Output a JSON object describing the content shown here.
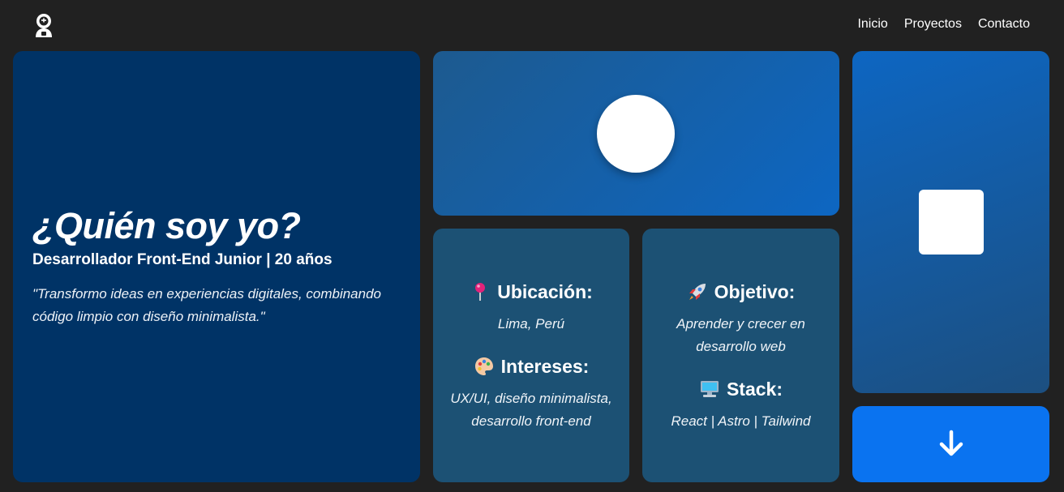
{
  "header": {
    "logo_icon": "astronaut-icon",
    "nav": [
      {
        "label": "Inicio"
      },
      {
        "label": "Proyectos"
      },
      {
        "label": "Contacto"
      }
    ]
  },
  "about": {
    "title": "¿Quién soy yo?",
    "subtitle": "Desarrollador Front-End Junior | 20 años",
    "quote": "\"Transformo ideas en experiencias digitales, combinando código limpio con diseño minimalista.\""
  },
  "info_left": {
    "location": {
      "icon": "pin-icon",
      "heading": "Ubicación:",
      "text": "Lima, Perú"
    },
    "interests": {
      "icon": "palette-icon",
      "heading": "Intereses:",
      "text": "UX/UI, diseño minimalista, desarrollo front-end"
    }
  },
  "info_right": {
    "goal": {
      "icon": "rocket-icon",
      "heading": "Objetivo:",
      "text": "Aprender y crecer en desarrollo web"
    },
    "stack": {
      "icon": "computer-icon",
      "heading": "Stack:",
      "text": "React | Astro | Tailwind"
    }
  },
  "scroll_button": {
    "icon": "arrow-down-icon"
  },
  "colors": {
    "background": "#212121",
    "about_card": "#003366",
    "info_card": "#1c5174",
    "accent": "#0a73f0"
  }
}
